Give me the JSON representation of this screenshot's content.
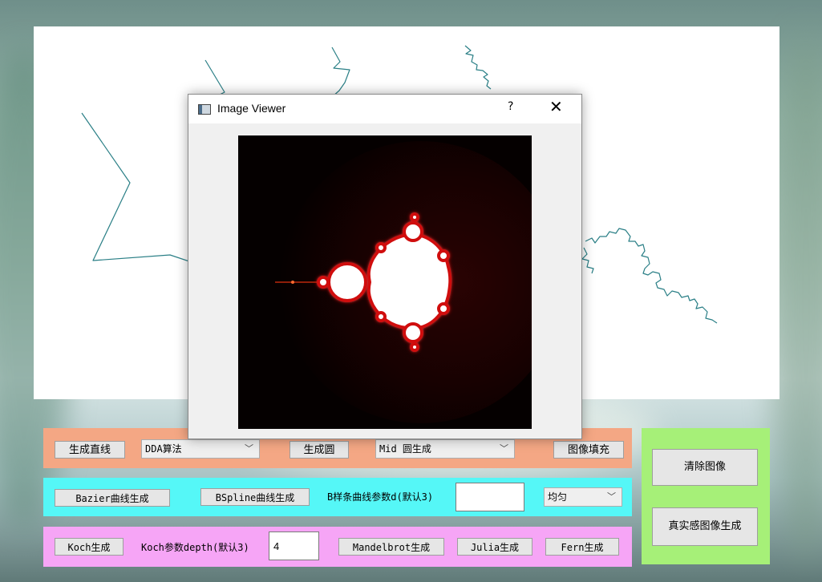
{
  "dialog": {
    "title": "Image Viewer",
    "help": "?",
    "close": "✕",
    "icon": "image-viewer-icon"
  },
  "row1": {
    "line_button": "生成直线",
    "line_algorithm": "DDA算法",
    "circle_button": "生成圆",
    "circle_algorithm": "Mid 圆生成",
    "fill_button": "图像填充"
  },
  "row2": {
    "bezier_button": "Bazier曲线生成",
    "bspline_button": "BSpline曲线生成",
    "bspline_param_label": "B样条曲线参数d(默认3)",
    "bspline_param_value": "",
    "knot_type": "均匀"
  },
  "row3": {
    "koch_button": "Koch生成",
    "koch_depth_label": "Koch参数depth(默认3)",
    "koch_depth_value": "4",
    "mandelbrot_button": "Mandelbrot生成",
    "julia_button": "Julia生成",
    "fern_button": "Fern生成"
  },
  "side": {
    "clear_button": "清除图像",
    "realistic_button": "真实感图像生成"
  },
  "colors": {
    "row1": "#f4a784",
    "row2": "#55f7f7",
    "row3": "#f6a5f6",
    "side": "#a6f078",
    "curve": "#2a7f86"
  }
}
